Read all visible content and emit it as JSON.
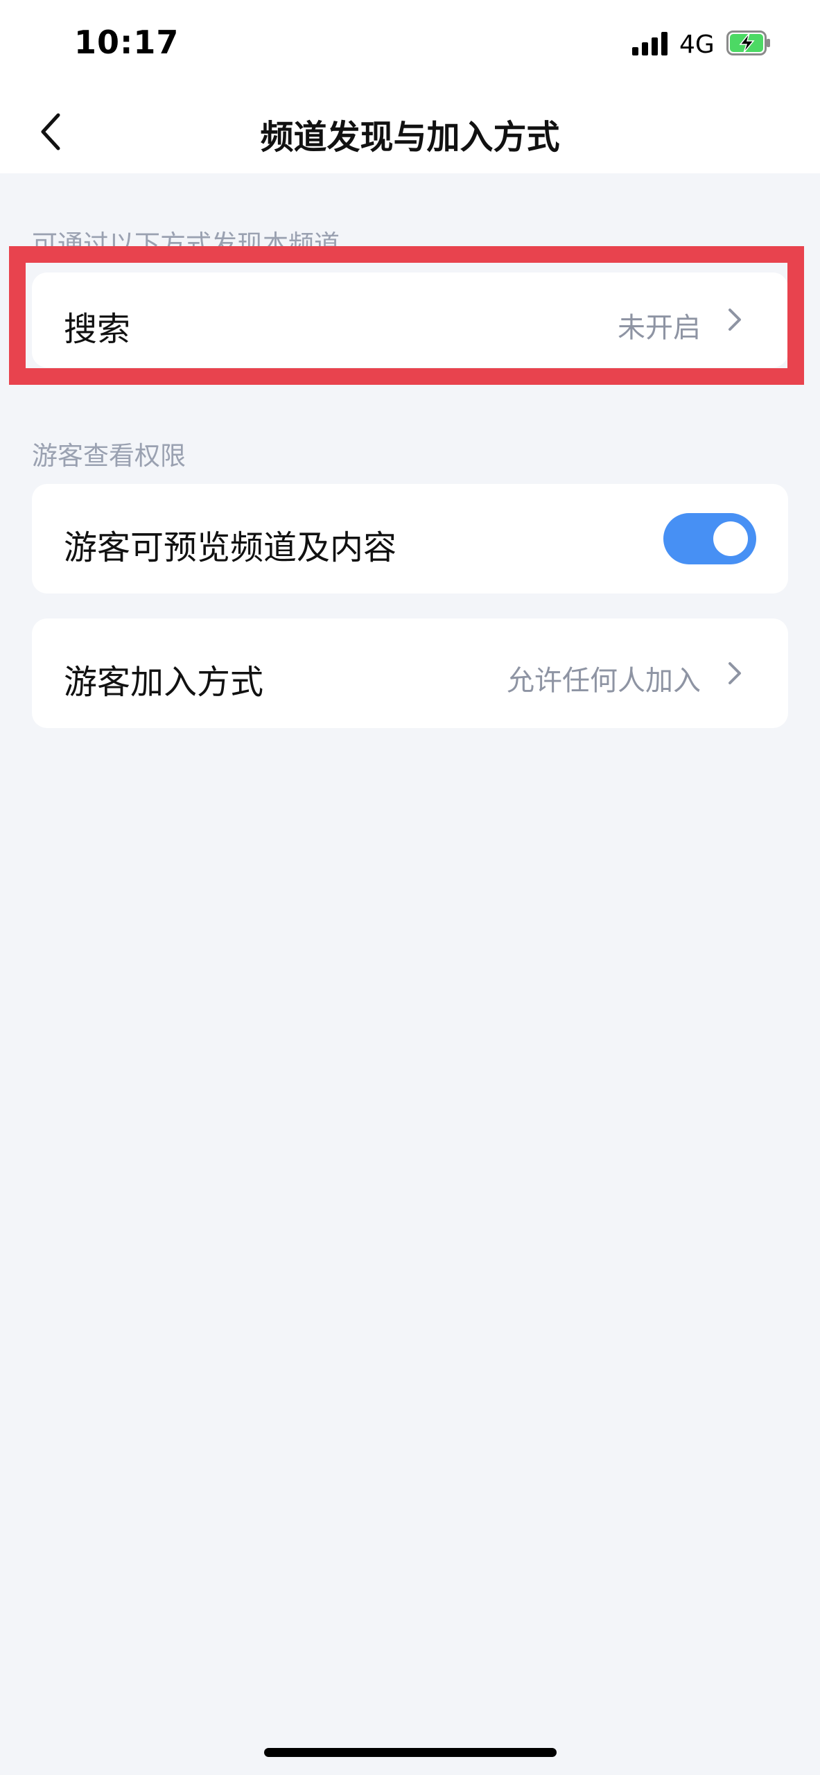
{
  "status_bar": {
    "time": "10:17",
    "network": "4G"
  },
  "nav": {
    "title": "频道发现与加入方式",
    "back_icon": "chevron-left-icon"
  },
  "discovery_section": {
    "label": "可通过以下方式发现本频道",
    "search_row": {
      "label": "搜索",
      "value": "未开启"
    }
  },
  "guest_section": {
    "label": "游客查看权限",
    "preview_row": {
      "label": "游客可预览频道及内容",
      "toggle_on": true
    },
    "join_row": {
      "label": "游客加入方式",
      "value": "允许任何人加入"
    }
  },
  "colors": {
    "accent": "#4790f4",
    "highlight": "#e8434e",
    "background": "#f3f5f9"
  }
}
